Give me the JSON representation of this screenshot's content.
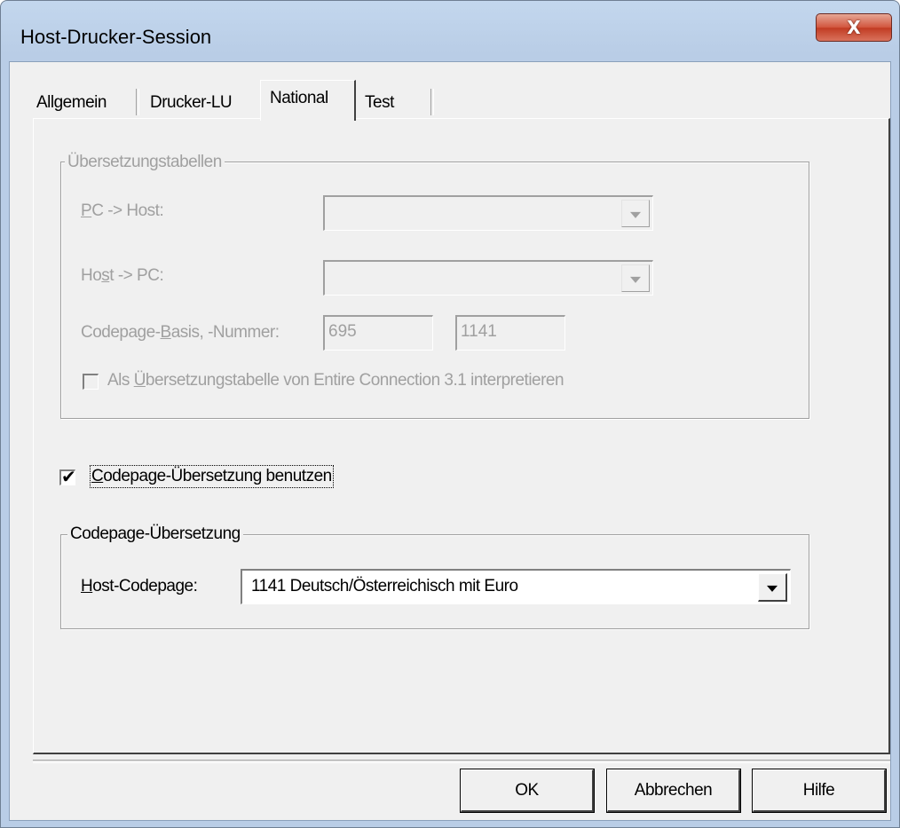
{
  "window": {
    "title": "Host-Drucker-Session",
    "close_glyph": "X"
  },
  "tabs": [
    {
      "label": "Allgemein",
      "active": false
    },
    {
      "label": "Drucker-LU",
      "active": false
    },
    {
      "label": "National",
      "active": true
    },
    {
      "label": "Test",
      "active": false
    }
  ],
  "translation_tables": {
    "group_title": "Übersetzungstabellen",
    "pc_host_label_u": "P",
    "pc_host_label_rest": "C -> Host:",
    "pc_host_value": "",
    "host_pc_label_pre": "Ho",
    "host_pc_label_u": "s",
    "host_pc_label_rest": "t -> PC:",
    "host_pc_value": "",
    "codepage_label_pre": "Codepage-",
    "codepage_label_u": "B",
    "codepage_label_rest": "asis, -Nummer:",
    "codepage_basis": "695",
    "codepage_number": "1141",
    "ec31_checked": false,
    "ec31_label_pre": "Als ",
    "ec31_label_u": "Ü",
    "ec31_label_rest": "bersetzungstabelle von Entire Connection 3.1 interpretieren"
  },
  "use_codepage": {
    "checked": true,
    "label_u": "C",
    "label_rest": "odepage-Übersetzung benutzen"
  },
  "codepage_translation": {
    "group_title": "Codepage-Übersetzung",
    "host_codepage_label_u": "H",
    "host_codepage_label_rest": "ost-Codepage:",
    "host_codepage_value": "1141 Deutsch/Österreichisch mit Euro"
  },
  "buttons": {
    "ok": "OK",
    "cancel": "Abbrechen",
    "help": "Hilfe"
  },
  "icons": {
    "checkmark_glyph": "✔"
  }
}
